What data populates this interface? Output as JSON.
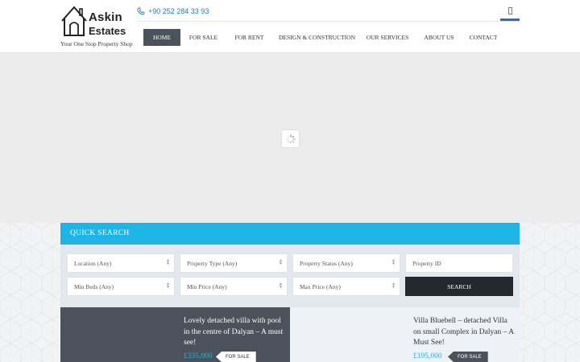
{
  "header": {
    "logo_line1": "Askin",
    "logo_line2": "Estates",
    "tagline": "Your One Stop Property Shop",
    "phone": "+90 252 284 33 93"
  },
  "nav": {
    "items": [
      {
        "label": "HOME",
        "active": true
      },
      {
        "label": "FOR SALE",
        "active": false
      },
      {
        "label": "FOR RENT",
        "active": false
      },
      {
        "label": "DESIGN & CONSTRUCTION",
        "active": false
      },
      {
        "label": "OUR SERVICES",
        "active": false
      },
      {
        "label": "ABOUT US",
        "active": false
      },
      {
        "label": "CONTACT",
        "active": false
      }
    ]
  },
  "quick_search": {
    "title": "QUICK SEARCH",
    "location": "Location (Any)",
    "property_type": "Property Type (Any)",
    "property_status": "Property Status (Any)",
    "property_id_placeholder": "Property ID",
    "min_beds": "Min Beds (Any)",
    "min_price": "Min Price (Any)",
    "max_price": "Max Price (Any)",
    "search_label": "SEARCH"
  },
  "listings": [
    {
      "title": "Lovely detached villa with pool in the centre of Dalyan – A must see!",
      "price": "£335,000",
      "status": "FOR SALE"
    },
    {
      "title": "Villa Bluebell – detached Villa on small Complex in Dalyan – A Must See!",
      "price": "£195,000",
      "status": "FOR SALE"
    }
  ],
  "colors": {
    "accent": "#1cb5e6",
    "nav_active": "#4b525c",
    "search_button": "#23282e",
    "phone": "#1a7fc1"
  }
}
